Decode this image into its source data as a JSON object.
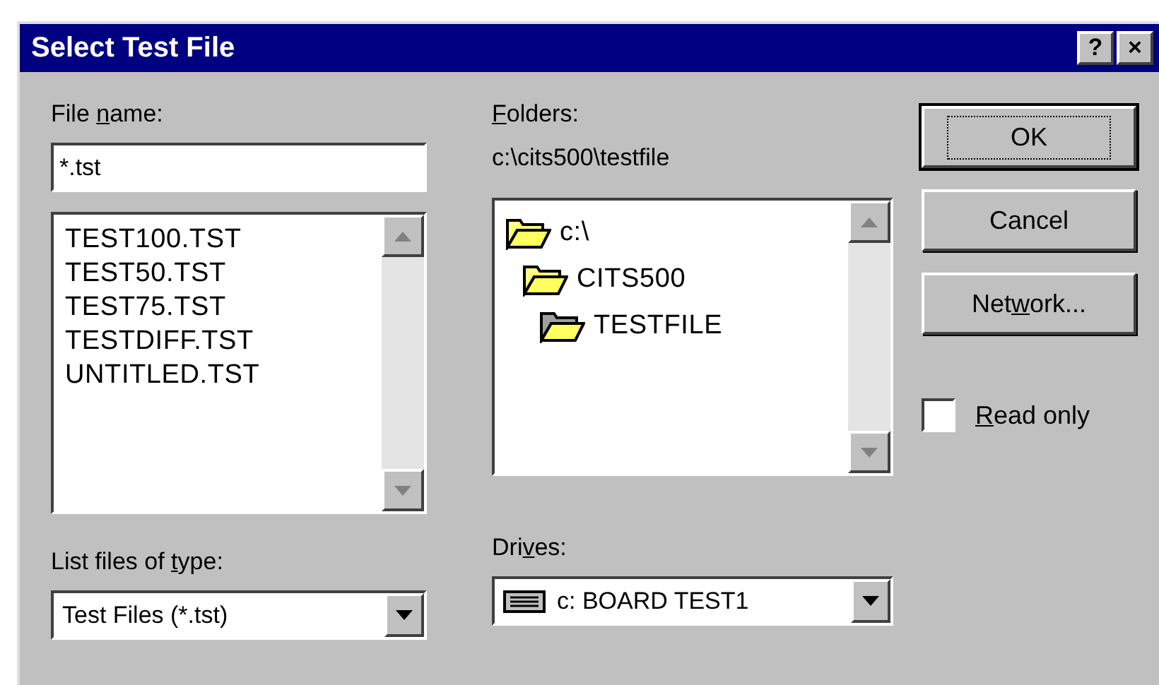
{
  "window": {
    "title": "Select Test File",
    "title_buttons": [
      "?",
      "×"
    ]
  },
  "file_name": {
    "label": {
      "before": "File ",
      "underlined": "n",
      "after": "ame:"
    },
    "value": "*.tst"
  },
  "files": [
    "TEST100.TST",
    "TEST50.TST",
    "TEST75.TST",
    "TESTDIFF.TST",
    "UNTITLED.TST"
  ],
  "folders": {
    "label": {
      "underlined": "F",
      "after": "olders:"
    },
    "path": "c:\\cits500\\testfile",
    "tree": [
      {
        "name": "c:\\",
        "selected": false,
        "children": [
          {
            "name": "CITS500",
            "selected": false,
            "children": [
              {
                "name": "TESTFILE",
                "selected": true
              }
            ]
          }
        ]
      }
    ]
  },
  "buttons": [
    {
      "label": {
        "before": "OK"
      },
      "default": true
    },
    {
      "label": {
        "before": "Cancel"
      },
      "default": false
    },
    {
      "label": {
        "before": "Net",
        "underlined": "w",
        "after": "ork..."
      },
      "default": false
    }
  ],
  "read_only": {
    "label": {
      "underlined": "R",
      "after": "ead only"
    },
    "checked": false
  },
  "file_type": {
    "label": {
      "before": "List files of ",
      "underlined": "t",
      "after": "ype:"
    },
    "value": "Test Files (*.tst)"
  },
  "drives": {
    "label": {
      "before": "Dri",
      "underlined": "v",
      "after": "es:"
    },
    "value": "c: BOARD TEST1"
  }
}
